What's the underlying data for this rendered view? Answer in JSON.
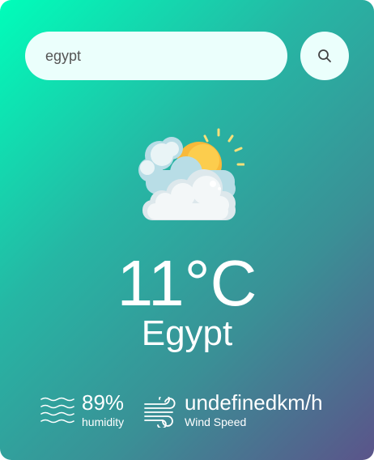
{
  "search": {
    "value": "egypt",
    "placeholder": "",
    "button_icon": "search-icon"
  },
  "weather": {
    "icon": "partly-cloudy-icon",
    "temperature": "11°C",
    "city": "Egypt"
  },
  "details": {
    "humidity": {
      "icon": "humidity-waves-icon",
      "value": "89%",
      "label": "humidity"
    },
    "wind": {
      "icon": "wind-icon",
      "value": "undefinedkm/h",
      "label": "Wind Speed"
    }
  },
  "colors": {
    "gradient_start": "#00feba",
    "gradient_end": "#5b548a",
    "input_background": "#ebfffc",
    "text": "#ffffff"
  }
}
